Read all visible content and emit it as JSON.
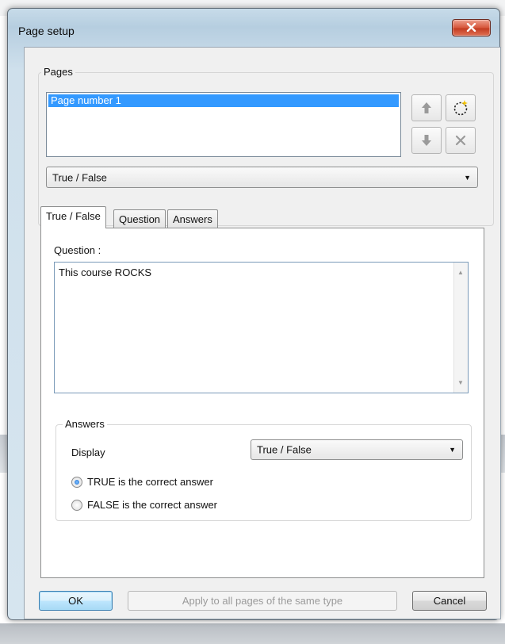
{
  "window": {
    "title": "Page setup"
  },
  "pages": {
    "legend": "Pages",
    "items": [
      {
        "label": "Page number 1",
        "selected": true
      }
    ],
    "page_type_value": "True / False"
  },
  "tabs": [
    {
      "label": "True / False",
      "active": true
    },
    {
      "label": "Question",
      "active": false
    },
    {
      "label": "Answers",
      "active": false
    }
  ],
  "question": {
    "label": "Question :",
    "text": "This course ROCKS"
  },
  "answers": {
    "legend": "Answers",
    "display_label": "Display",
    "display_value": "True / False",
    "options": [
      {
        "label": "TRUE is the correct answer",
        "checked": true
      },
      {
        "label": "FALSE is the correct answer",
        "checked": false
      }
    ]
  },
  "buttons": {
    "ok": "OK",
    "apply": "Apply to all pages of the same type",
    "cancel": "Cancel"
  },
  "icons": {
    "move_up": "arrow-up-icon",
    "move_down": "arrow-down-icon",
    "new_page": "new-page-icon",
    "delete": "delete-x-icon",
    "close": "close-icon"
  },
  "colors": {
    "selection": "#3399ff",
    "close_button": "#c23b20",
    "title_bar": "#c7dbe9"
  }
}
